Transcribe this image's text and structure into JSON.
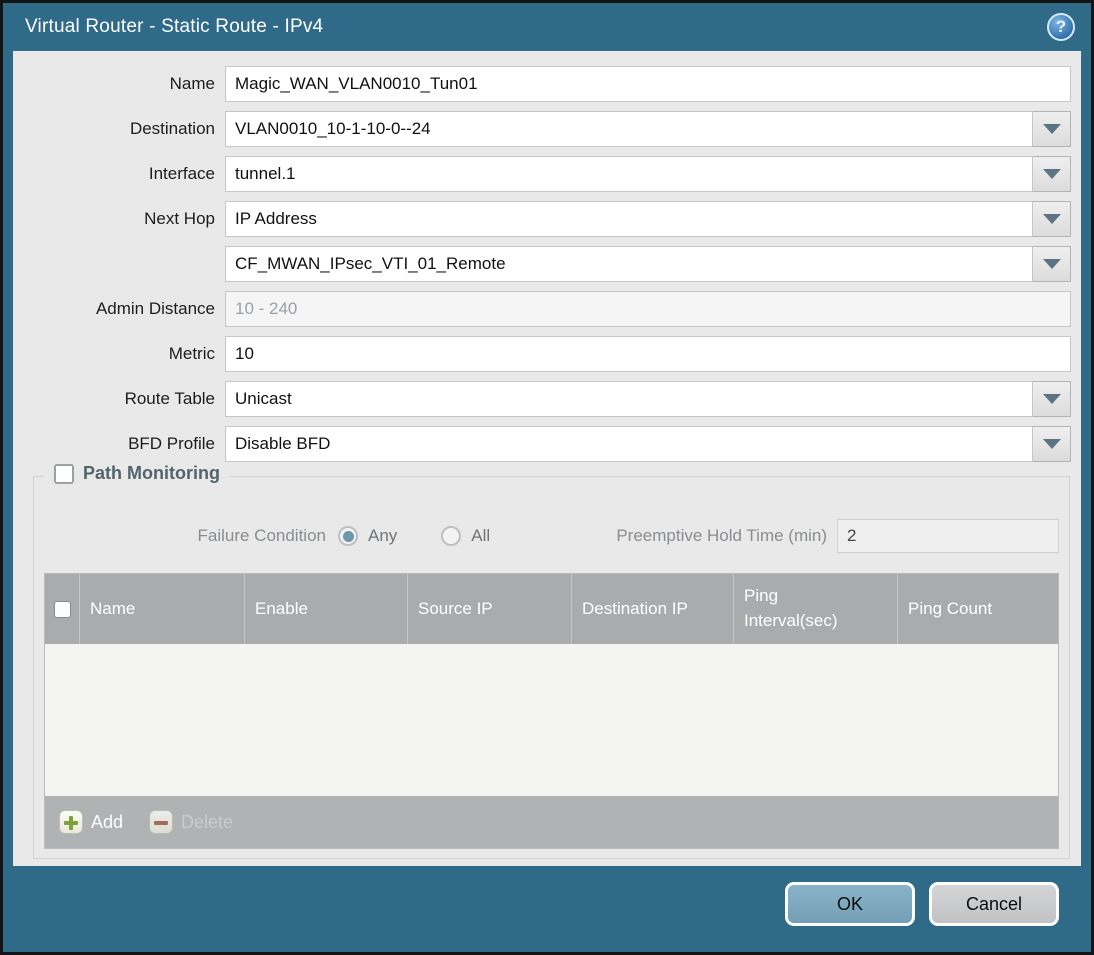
{
  "window": {
    "title": "Virtual Router - Static Route - IPv4",
    "help_glyph": "?"
  },
  "form": {
    "fields": [
      {
        "label": "Name",
        "value": "Magic_WAN_VLAN0010_Tun01",
        "type": "text"
      },
      {
        "label": "Destination",
        "value": "VLAN0010_10-1-10-0--24",
        "type": "dropdown"
      },
      {
        "label": "Interface",
        "value": "tunnel.1",
        "type": "dropdown"
      },
      {
        "label": "Next Hop",
        "value": "IP Address",
        "type": "dropdown"
      },
      {
        "label": "",
        "value": "CF_MWAN_IPsec_VTI_01_Remote",
        "type": "dropdown"
      },
      {
        "label": "Admin Distance",
        "value": "",
        "placeholder": "10 - 240",
        "type": "text"
      },
      {
        "label": "Metric",
        "value": "10",
        "type": "text"
      },
      {
        "label": "Route Table",
        "value": "Unicast",
        "type": "dropdown"
      },
      {
        "label": "BFD Profile",
        "value": "Disable BFD",
        "type": "dropdown"
      }
    ]
  },
  "path_monitoring": {
    "title": "Path Monitoring",
    "checkbox_checked": false,
    "failure_condition": {
      "label": "Failure Condition",
      "options": [
        "Any",
        "All"
      ],
      "selected": "Any"
    },
    "preemptive_hold": {
      "label": "Preemptive Hold Time (min)",
      "value": "2"
    },
    "table": {
      "columns": [
        "Name",
        "Enable",
        "Source IP",
        "Destination IP",
        "Ping Interval(sec)",
        "Ping Count"
      ],
      "rows": []
    },
    "actions": {
      "add": "Add",
      "delete": "Delete",
      "delete_enabled": false
    }
  },
  "buttons": {
    "ok": "OK",
    "cancel": "Cancel"
  },
  "colors": {
    "frame_teal": "#2f6b89",
    "body_grey": "#e9e9e9",
    "table_header_grey": "#a9abad",
    "ok_button_blue": "#7fabc1",
    "add_plus_green": "#7da23c",
    "delete_minus_red": "#9d5c51",
    "radio_selected_teal": "#6e97ac"
  }
}
